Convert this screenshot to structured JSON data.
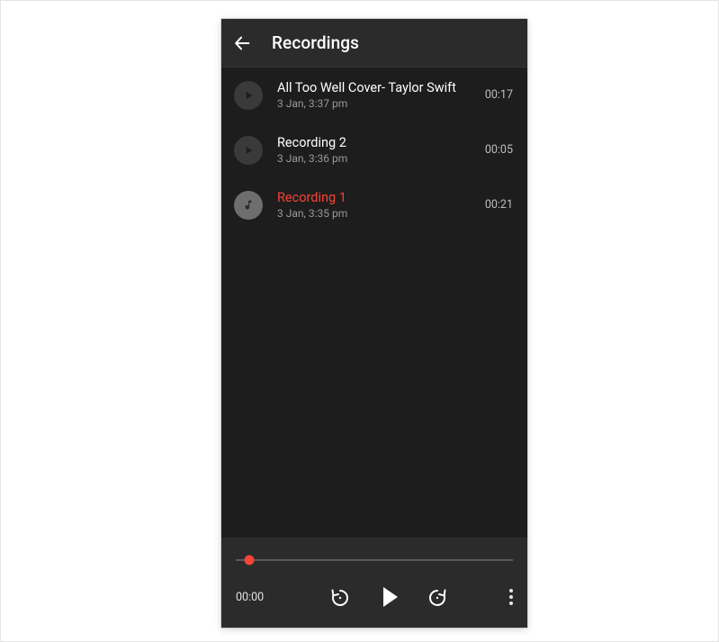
{
  "colors": {
    "accent": "#f44437",
    "background": "#1e1d1d",
    "chrome": "#2b2b2b"
  },
  "header": {
    "title": "Recordings"
  },
  "recordings": [
    {
      "icon": "play-circle-icon",
      "name": "All Too Well Cover- Taylor Swift",
      "meta": "3 Jan, 3:37 pm",
      "duration": "00:17",
      "active": false
    },
    {
      "icon": "play-circle-icon",
      "name": "Recording 2",
      "meta": "3 Jan, 3:36 pm",
      "duration": "00:05",
      "active": false
    },
    {
      "icon": "music-note-icon",
      "name": "Recording 1",
      "meta": "3 Jan, 3:35 pm",
      "duration": "00:21",
      "active": true
    }
  ],
  "player": {
    "position_label": "00:00",
    "progress_pct": 5
  }
}
